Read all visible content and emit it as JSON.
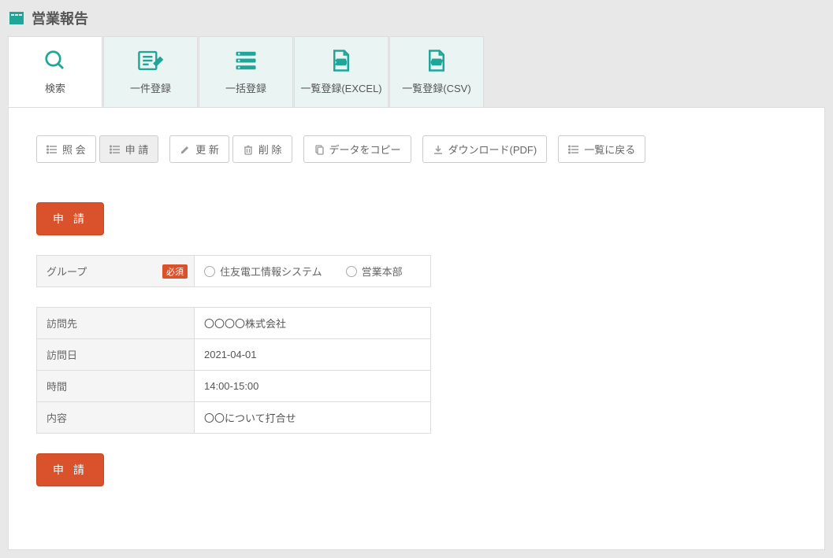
{
  "header": {
    "title": "営業報告"
  },
  "tabs": [
    {
      "label": "検索"
    },
    {
      "label": "一件登録"
    },
    {
      "label": "一括登録"
    },
    {
      "label": "一覧登録(EXCEL)"
    },
    {
      "label": "一覧登録(CSV)"
    }
  ],
  "toolbar": {
    "view": "照 会",
    "apply": "申 請",
    "update": "更 新",
    "delete": "削 除",
    "copy": "データをコピー",
    "download_pdf": "ダウンロード(PDF)",
    "back_list": "一覧に戻る"
  },
  "buttons": {
    "apply_label": "申 請"
  },
  "group": {
    "label": "グループ",
    "required": "必須",
    "options": [
      "住友電工情報システム",
      "営業本部"
    ]
  },
  "details": [
    {
      "label": "訪問先",
      "value": "〇〇〇〇株式会社"
    },
    {
      "label": "訪問日",
      "value": "2021-04-01"
    },
    {
      "label": "時間",
      "value": "14:00-15:00"
    },
    {
      "label": "内容",
      "value": "〇〇について打合せ"
    }
  ]
}
